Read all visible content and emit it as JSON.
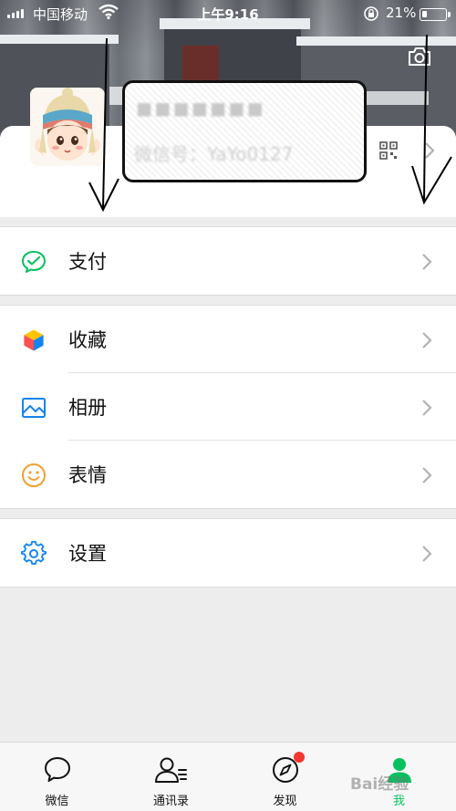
{
  "status_bar": {
    "carrier": "中国移动",
    "time": "上午9:16",
    "battery_percent_label": "21%",
    "battery_level": 0.21
  },
  "profile": {
    "name_redacted": "◼◼◼◼◼◼◼",
    "wechat_id": "微信号：YaYo0127"
  },
  "menu_groups": [
    [
      {
        "label": "支付",
        "icon": "wechat-pay-icon"
      }
    ],
    [
      {
        "label": "收藏",
        "icon": "favorites-cube-icon"
      },
      {
        "label": "相册",
        "icon": "album-icon"
      },
      {
        "label": "表情",
        "icon": "sticker-smile-icon"
      }
    ],
    [
      {
        "label": "设置",
        "icon": "settings-gear-icon"
      }
    ]
  ],
  "tabs": [
    {
      "label": "微信",
      "icon": "chat-icon"
    },
    {
      "label": "通讯录",
      "icon": "contacts-icon"
    },
    {
      "label": "发现",
      "icon": "compass-icon"
    },
    {
      "label": "我",
      "icon": "me-icon"
    }
  ],
  "watermark": "Bai经验",
  "colors": {
    "accent_green": "#07c160",
    "badge_red": "#f43530",
    "settings_blue": "#1485ee",
    "sticker_orange": "#f0a030"
  }
}
